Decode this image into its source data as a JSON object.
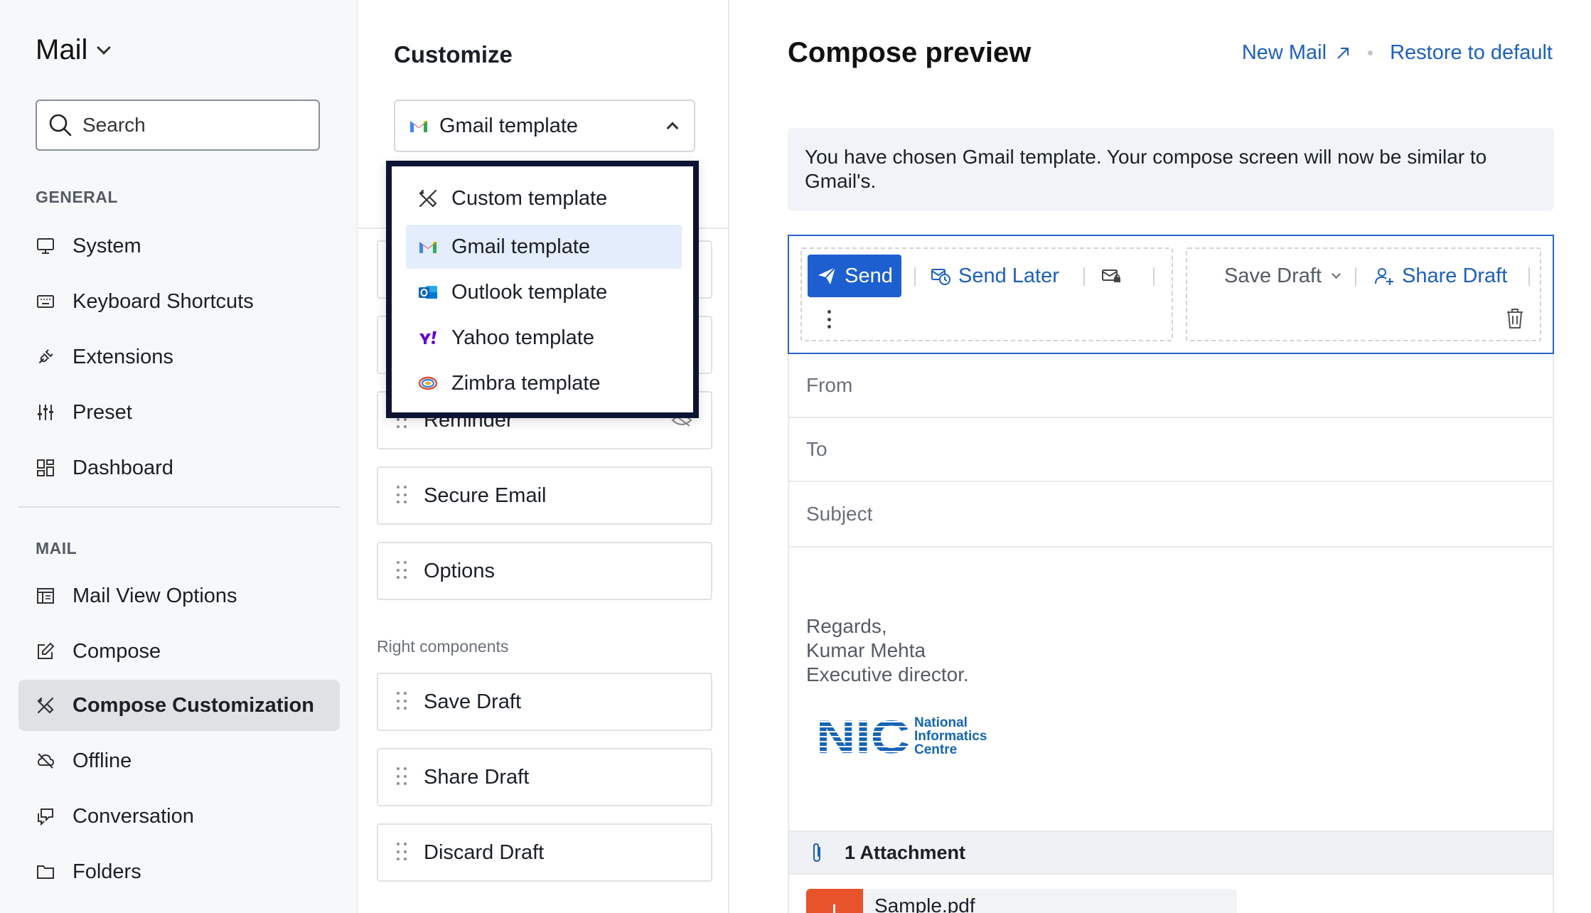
{
  "sidebar": {
    "app_title": "Mail",
    "search_placeholder": "Search",
    "general_label": "GENERAL",
    "general_items": [
      {
        "label": "System",
        "icon": "monitor-icon"
      },
      {
        "label": "Keyboard Shortcuts",
        "icon": "keyboard-icon"
      },
      {
        "label": "Extensions",
        "icon": "plug-icon"
      },
      {
        "label": "Preset",
        "icon": "sliders-icon"
      },
      {
        "label": "Dashboard",
        "icon": "dashboard-icon"
      }
    ],
    "mail_label": "MAIL",
    "mail_items": [
      {
        "label": "Mail View Options",
        "icon": "layout-icon"
      },
      {
        "label": "Compose",
        "icon": "edit-icon"
      },
      {
        "label": "Compose Customization",
        "icon": "tools-icon",
        "active": true
      },
      {
        "label": "Offline",
        "icon": "cloud-off-icon"
      },
      {
        "label": "Conversation",
        "icon": "chat-icon"
      },
      {
        "label": "Folders",
        "icon": "folder-icon"
      }
    ]
  },
  "customize": {
    "title": "Customize",
    "selected_template": "Gmail template",
    "dropdown_options": [
      {
        "label": "Custom template",
        "icon": "tools-icon"
      },
      {
        "label": "Gmail template",
        "icon": "gmail-icon",
        "selected": true
      },
      {
        "label": "Outlook template",
        "icon": "outlook-icon"
      },
      {
        "label": "Yahoo template",
        "icon": "yahoo-icon"
      },
      {
        "label": "Zimbra template",
        "icon": "zimbra-icon"
      }
    ],
    "hidden_row_label": "Reminder",
    "left_components": [
      "Secure Email",
      "Options"
    ],
    "right_components_label": "Right components",
    "right_components": [
      "Save Draft",
      "Share Draft",
      "Discard Draft"
    ]
  },
  "preview": {
    "title": "Compose preview",
    "new_mail_link": "New Mail",
    "restore_link": "Restore to default",
    "info_text": "You have chosen Gmail template. Your compose screen will now be similar to Gmail's.",
    "toolbar": {
      "send": "Send",
      "send_later": "Send Later",
      "save_draft": "Save Draft",
      "share_draft": "Share Draft"
    },
    "fields": {
      "from": "From",
      "to": "To",
      "subject": "Subject"
    },
    "signature": {
      "line1": "Regards,",
      "line2": "Kumar Mehta",
      "line3": "Executive director.",
      "logo_mark": "NIC",
      "logo_text_1": "National",
      "logo_text_2": "Informatics",
      "logo_text_3": "Centre"
    },
    "attachments": {
      "count_label": "1 Attachment",
      "file_name": "Sample.pdf"
    }
  },
  "colors": {
    "accent": "#1e5fd0",
    "link": "#1d5fbf",
    "dropdown_border": "#0d1433",
    "selected_option_bg": "#e3edfc",
    "active_nav_bg": "#dfe1e5",
    "pdf_icon": "#e8532b"
  }
}
